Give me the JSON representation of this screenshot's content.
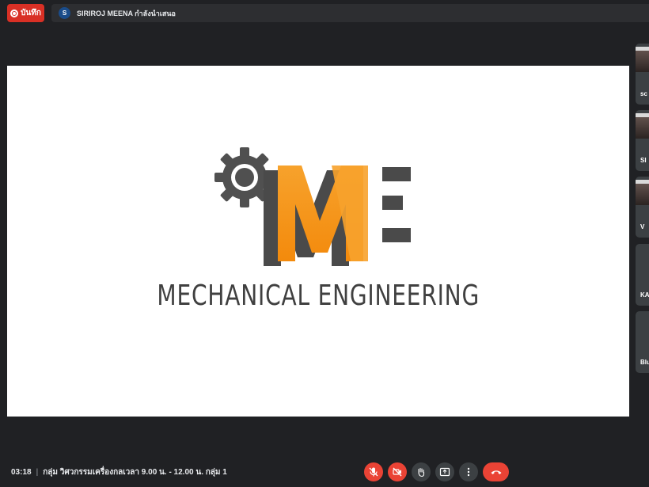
{
  "topbar": {
    "record_label": "บันทึก",
    "presenter_initial": "S",
    "presenter_text": "SIRIROJ MEENA กำลังนำเสนอ"
  },
  "slide": {
    "logo_letters": "ME",
    "caption": "MECHANICAL ENGINEERING",
    "colors": {
      "accent": "#f59b1b",
      "dark": "#4a4a4a",
      "gear": "#505050"
    }
  },
  "participants": [
    {
      "name": "sc",
      "kind": "video"
    },
    {
      "name": "SI",
      "kind": "video"
    },
    {
      "name": "V",
      "kind": "video"
    },
    {
      "name": "KA",
      "kind": "avatar"
    },
    {
      "name": "Blu",
      "kind": "avatar"
    }
  ],
  "footer": {
    "time": "03:18",
    "separator": "|",
    "meeting_title": "กลุ่ม วิศวกรรมเครื่องกลเวลา 9.00 น. - 12.00 น. กลุ่ม 1"
  },
  "controls": [
    {
      "icon": "mic-off-icon",
      "state": "off",
      "color": "#ea4335"
    },
    {
      "icon": "camera-off-icon",
      "state": "off",
      "color": "#ea4335"
    },
    {
      "icon": "raise-hand-icon",
      "state": "normal",
      "color": "#3c4043"
    },
    {
      "icon": "present-screen-icon",
      "state": "normal",
      "color": "#3c4043"
    },
    {
      "icon": "more-options-icon",
      "state": "normal",
      "color": "#3c4043"
    },
    {
      "icon": "hang-up-icon",
      "state": "end",
      "color": "#ea4335"
    }
  ]
}
